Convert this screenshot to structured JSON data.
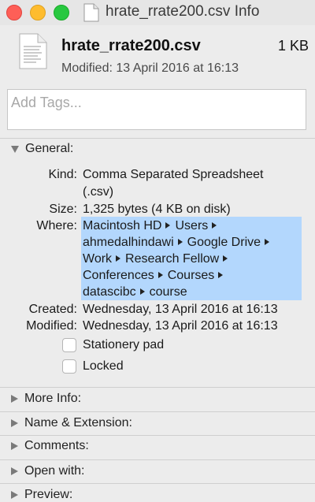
{
  "window": {
    "title": "hrate_rrate200.csv Info"
  },
  "header": {
    "filename": "hrate_rrate200.csv",
    "size": "1 KB",
    "modified": "Modified: 13 April 2016 at 16:13"
  },
  "tags": {
    "placeholder": "Add Tags..."
  },
  "general": {
    "heading": "General:",
    "kind_label": "Kind:",
    "kind_line1": "Comma Separated Spreadsheet",
    "kind_line2": "(.csv)",
    "size_label": "Size:",
    "size_value": "1,325 bytes (4 KB on disk)",
    "where_label": "Where:",
    "where": {
      "l1a": "Macintosh HD",
      "l1b": "Users",
      "l2a": "ahmedalhindawi",
      "l2b": "Google Drive",
      "l3a": "Work",
      "l3b": "Research Fellow",
      "l4a": "Conferences",
      "l4b": "Courses",
      "l5a": "datascibc",
      "l5b": "course"
    },
    "created_label": "Created:",
    "created_value": "Wednesday, 13 April 2016 at 16:13",
    "modified_label": "Modified:",
    "modified_value": "Wednesday, 13 April 2016 at 16:13",
    "stationery_label": "Stationery pad",
    "locked_label": "Locked"
  },
  "sections": {
    "more_info": "More Info:",
    "name_ext": "Name & Extension:",
    "comments": "Comments:",
    "open_with": "Open with:",
    "preview": "Preview:"
  },
  "colors": {
    "close": "#fe5f57",
    "minimize": "#febc2e",
    "maximize": "#28c840",
    "selection": "#b3d7fd"
  }
}
